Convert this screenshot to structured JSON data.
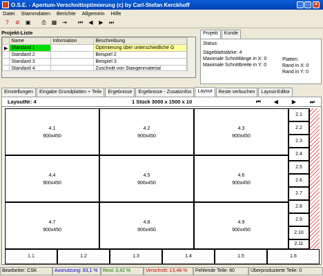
{
  "window": {
    "title": "O.S.E. - Apertum-Verschnittoptimierung (c) by Carl-Stefan Kerckhoff"
  },
  "menu": [
    "Datei",
    "Stammdaten",
    "Berichte",
    "Allgemein",
    "Hilfe"
  ],
  "projects": {
    "label": "Projekt-Liste",
    "headers": [
      "Name",
      "Information",
      "Beschreibung"
    ],
    "rows": [
      {
        "name": "Standard 1",
        "info": "",
        "desc": "Optimierung über unterschiedliche G"
      },
      {
        "name": "Standard 2",
        "info": "",
        "desc": "Beispiel 2"
      },
      {
        "name": "Standard 3",
        "info": "",
        "desc": "Beispiel 3"
      },
      {
        "name": "Standard 4",
        "info": "",
        "desc": "Zuschnitt von Stangenmaterial"
      }
    ]
  },
  "right_panel": {
    "tabs": [
      "Projekt",
      "Kunde"
    ],
    "status_label": "Status:",
    "saw_width": "Sägeblattstärke: 4",
    "max_cut_x": "Maximale Schnittlänge in X: 0",
    "max_cut_y": "Maximale Schnittbreite in Y: 0",
    "plates": "Platten:",
    "edge_x": "Rand in X: 0",
    "edge_y": "Rand in Y: 0"
  },
  "tabs": [
    "Einstellungen",
    "Eingabe Grundplatten + Teile",
    "Ergebnisse",
    "Ergebnisse - Zusatzinfos",
    "Layout",
    "Reste verbuchen",
    "Layout-Editor"
  ],
  "active_tab": "Layout",
  "layout": {
    "number": "LayoutNr: 4",
    "summary": "1 Stück 3000 x 1500 x 10",
    "pieces": [
      {
        "id": "4.1",
        "size": "900x450"
      },
      {
        "id": "4.2",
        "size": "900x450"
      },
      {
        "id": "4.3",
        "size": "900x450"
      },
      {
        "id": "4.4",
        "size": "900x450"
      },
      {
        "id": "4.5",
        "size": "900x450"
      },
      {
        "id": "4.6",
        "size": "900x450"
      },
      {
        "id": "4.7",
        "size": "900x450"
      },
      {
        "id": "4.8",
        "size": "900x450"
      },
      {
        "id": "4.9",
        "size": "900x450"
      }
    ],
    "right_strips": [
      "2.1",
      "2.2",
      "2.3",
      "2.4",
      "2.5",
      "2.6",
      "2.7",
      "2.8",
      "2.9",
      "2.10",
      "2.11"
    ],
    "bottom_strips": [
      "1.1",
      "1.2",
      "1.3",
      "1.4",
      "1.5",
      "1.6"
    ]
  },
  "statusbar": {
    "user": "Bearbeiter: CSK",
    "usage": "Ausnutzung: 83,1 %",
    "rest": "Rest: 3,42 %",
    "waste": "Verschnitt: 13,48 %",
    "missing": "Fehlende Teile: 60",
    "over": "Überproduzierte Teile: 0"
  },
  "colors": {
    "usage": "#0000cc",
    "rest": "#008000",
    "waste": "#cc0000",
    "selected_row": "#00e000",
    "highlight_cell": "#ffff99"
  }
}
